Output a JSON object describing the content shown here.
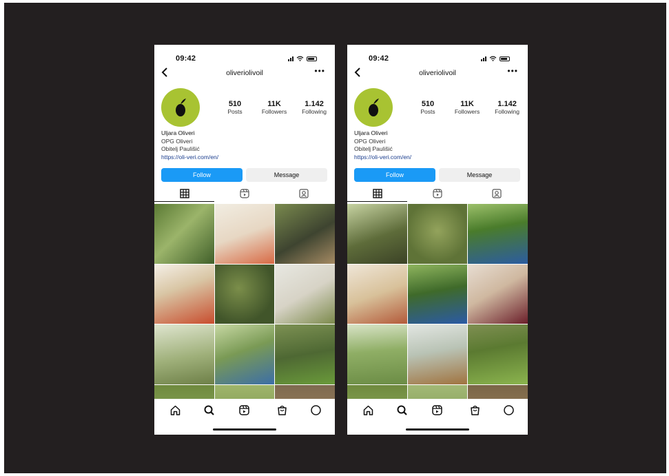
{
  "phones": [
    {
      "status": {
        "time": "09:42"
      },
      "header": {
        "username": "oliveriolivoil"
      },
      "profile": {
        "stats": [
          {
            "value": "510",
            "label": "Posts"
          },
          {
            "value": "11K",
            "label": "Followers"
          },
          {
            "value": "1.142",
            "label": "Following"
          }
        ],
        "bio": {
          "name": "Uljara Oliveri",
          "line1": "OPG Oliveri",
          "line2": "Obitelj Paulišić",
          "link": "https://oli-veri.com/en/"
        },
        "buttons": {
          "follow": "Follow",
          "message": "Message"
        }
      },
      "grid": [
        {
          "bg": "linear-gradient(135deg,#5b7a34,#9bb46a 45%,#41602a)",
          "subject": "olive branch"
        },
        {
          "bg": "linear-gradient(160deg,#f1ede2,#e7d7c3 50%,#d86a45)",
          "subject": "sliced tomatoes"
        },
        {
          "bg": "linear-gradient(150deg,#7a8a4e,#3e4430 55%,#a58a63)",
          "subject": "bottle on bark"
        },
        {
          "bg": "linear-gradient(160deg,#f4efe6,#d9c6a5 40%,#c84d2e)",
          "subject": "pouring oil"
        },
        {
          "bg": "radial-gradient(circle at 40% 40%,#7b8e4a,#41552a 70%)",
          "subject": "aerial olive grove"
        },
        {
          "bg": "linear-gradient(150deg,#e8e8e2,#d7d3c6 50%,#7c8a4c)",
          "subject": "bottle labels"
        },
        {
          "bg": "linear-gradient(170deg,#dfe5cf,#9fb07a 55%,#6d7f47)",
          "subject": "olive trees"
        },
        {
          "bg": "linear-gradient(160deg,#c7d8a3,#7a9a55 45%,#3c6ea7)",
          "subject": "couple picnic"
        },
        {
          "bg": "linear-gradient(170deg,#7d9153,#4e6833 50%,#6a9a3a)",
          "subject": "grove lawn"
        },
        {
          "bg": "linear-gradient(180deg,#6f8a3e,#98b56a)",
          "subject": "olive tree"
        },
        {
          "bg": "linear-gradient(180deg,#9fb56b,#6d8944)",
          "subject": "olive tree"
        },
        {
          "bg": "linear-gradient(180deg,#7f6a50,#a68c64)",
          "subject": "olive trunk"
        }
      ]
    },
    {
      "status": {
        "time": "09:42"
      },
      "header": {
        "username": "oliveriolivoil"
      },
      "profile": {
        "stats": [
          {
            "value": "510",
            "label": "Posts"
          },
          {
            "value": "11K",
            "label": "Followers"
          },
          {
            "value": "1.142",
            "label": "Following"
          }
        ],
        "bio": {
          "name": "Uljara Oliveri",
          "line1": "OPG Oliveri",
          "line2": "Obitelj Paulišić",
          "link": "https://oli-veri.com/en/"
        },
        "buttons": {
          "follow": "Follow",
          "message": "Message"
        }
      },
      "grid": [
        {
          "bg": "linear-gradient(160deg,#c7d3a2,#5e6c3a 55%,#3b4226)",
          "subject": "three bottles"
        },
        {
          "bg": "radial-gradient(circle at 50% 45%,#93a35c,#5f7337 70%)",
          "subject": "aerial rows"
        },
        {
          "bg": "linear-gradient(170deg,#9cc06a,#4a7c2b 40%,#2c5ca0)",
          "subject": "man in hat"
        },
        {
          "bg": "linear-gradient(160deg,#efe6d8,#d8c19a 50%,#b35a3a)",
          "subject": "tasting table"
        },
        {
          "bg": "linear-gradient(170deg,#8fb55e,#3f6a2a 45%,#2b5aa5)",
          "subject": "harvest crate"
        },
        {
          "bg": "linear-gradient(150deg,#e7ddd2,#cfb8a0 45%,#6b1f2a)",
          "subject": "bottle in hand"
        },
        {
          "bg": "linear-gradient(175deg,#d8e3c6,#8fae65 45%,#6b8c45)",
          "subject": "man in grove"
        },
        {
          "bg": "linear-gradient(170deg,#e2e6e2,#b9c3b5 45%,#a0733f)",
          "subject": "woman at table"
        },
        {
          "bg": "linear-gradient(170deg,#7f8f52,#5b7a31 40%,#8bb44e)",
          "subject": "green olives crate"
        },
        {
          "bg": "linear-gradient(180deg,#6f8a3e,#9cb96c)",
          "subject": "trees"
        },
        {
          "bg": "linear-gradient(180deg,#a3b976,#6f8d46)",
          "subject": "trees"
        },
        {
          "bg": "linear-gradient(180deg,#7b6648,#a38a62)",
          "subject": "trunk"
        }
      ]
    }
  ],
  "colors": {
    "background": "#231f20",
    "follow_button": "#1a9af6",
    "brand_avatar": "#a8c332",
    "link": "#1b3e8e"
  },
  "icons": [
    "back-arrow-icon",
    "more-options-icon",
    "grid-tab-icon",
    "reels-tab-icon",
    "tagged-tab-icon",
    "home-icon",
    "search-icon",
    "reels-icon",
    "shop-icon",
    "profile-icon"
  ]
}
